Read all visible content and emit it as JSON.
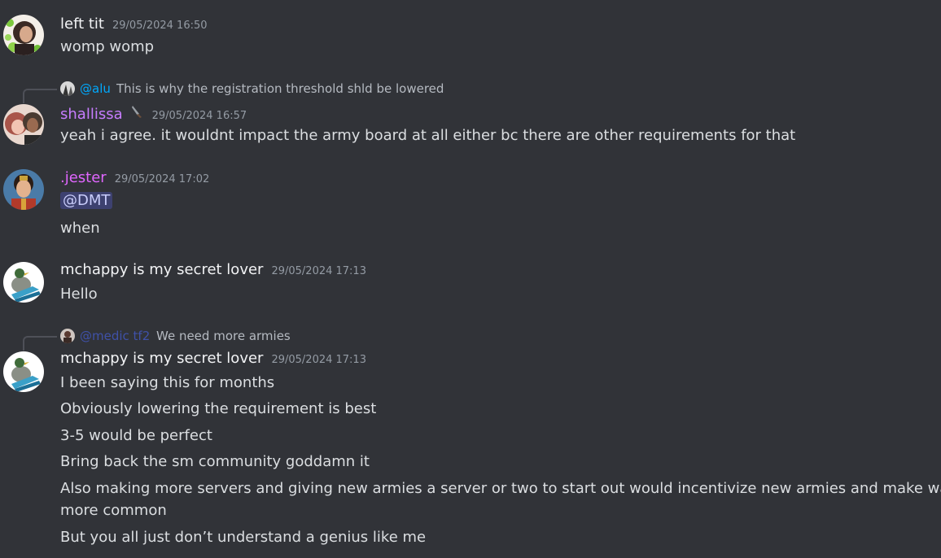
{
  "messages": [
    {
      "username": "left tit",
      "timestamp": "29/05/2024 16:50",
      "lines": [
        "womp womp"
      ]
    },
    {
      "reply": {
        "user": "@alu",
        "text": "This is why the registration threshold shld be lowered"
      },
      "username": "shallissa",
      "timestamp": "29/05/2024 16:57",
      "lines": [
        "yeah i agree. it wouldnt impact the army board at all either bc there are other requirements for that"
      ]
    },
    {
      "username": ".jester",
      "timestamp": "29/05/2024 17:02",
      "mention": "@DMT",
      "lines": [
        "when"
      ]
    },
    {
      "username": "mchappy is my secret lover",
      "timestamp": "29/05/2024 17:13",
      "lines": [
        "Hello"
      ]
    },
    {
      "reply": {
        "user": "@medic tf2",
        "text": "We need more armies"
      },
      "username": "mchappy is my secret lover",
      "timestamp": "29/05/2024 17:13",
      "lines": [
        "I been saying this for months",
        "Obviously lowering the requirement is best",
        "3-5 would be perfect",
        "Bring back the sm community goddamn it",
        "Also making more servers and giving new armies a server or two to start out would incentivize new armies and make wars",
        "more common",
        "But you all just don’t understand a genius like me"
      ]
    }
  ],
  "colors": {
    "background": "#313338",
    "username_default": "#f2f3f5",
    "username_shallissa": "#c77dff",
    "username_jester": "#e066ff",
    "mention_bg": "#4e559f"
  }
}
